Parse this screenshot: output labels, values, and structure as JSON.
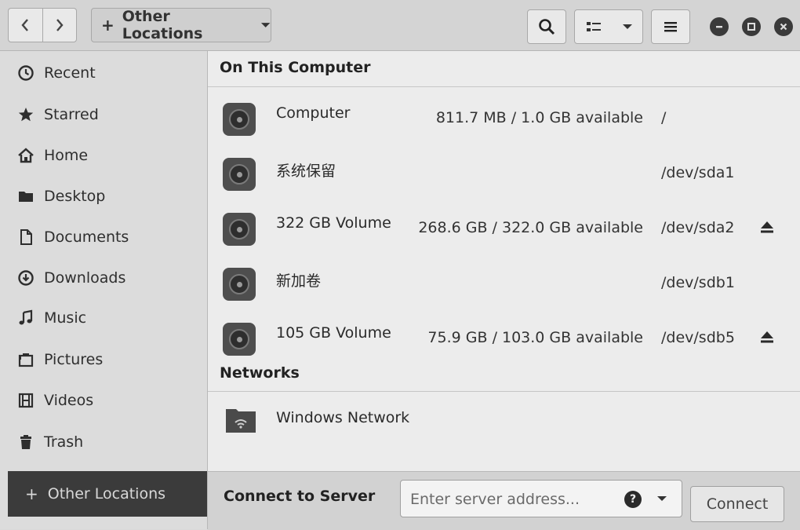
{
  "headerbar": {
    "path_label": "Other Locations",
    "icons": [
      "back-icon",
      "forward-icon",
      "search-icon",
      "list-view-icon",
      "menu-icon",
      "minimize-icon",
      "maximize-icon",
      "close-icon"
    ]
  },
  "sidebar": {
    "items": [
      {
        "label": "Recent",
        "icon": "clock-icon"
      },
      {
        "label": "Starred",
        "icon": "star-icon"
      },
      {
        "label": "Home",
        "icon": "home-icon"
      },
      {
        "label": "Desktop",
        "icon": "folder-icon"
      },
      {
        "label": "Documents",
        "icon": "document-icon"
      },
      {
        "label": "Downloads",
        "icon": "download-icon"
      },
      {
        "label": "Music",
        "icon": "music-icon"
      },
      {
        "label": "Pictures",
        "icon": "picture-icon"
      },
      {
        "label": "Videos",
        "icon": "film-icon"
      },
      {
        "label": "Trash",
        "icon": "trash-icon"
      }
    ],
    "other_locations": "Other Locations"
  },
  "main": {
    "on_this_computer": "On This Computer",
    "volumes": [
      {
        "name": "Computer",
        "available": "811.7 MB / 1.0 GB available",
        "device": "/",
        "ejectable": false
      },
      {
        "name": "系统保留",
        "available": "",
        "device": "/dev/sda1",
        "ejectable": false
      },
      {
        "name": "322 GB Volume",
        "available": "268.6 GB / 322.0 GB available",
        "device": "/dev/sda2",
        "ejectable": true
      },
      {
        "name": "新加卷",
        "available": "",
        "device": "/dev/sdb1",
        "ejectable": false
      },
      {
        "name": "105 GB Volume",
        "available": "75.9 GB / 103.0 GB available",
        "device": "/dev/sdb5",
        "ejectable": true
      }
    ],
    "networks": "Networks",
    "network_items": [
      {
        "name": "Windows Network",
        "icon": "network-folder-icon"
      }
    ]
  },
  "connect": {
    "label": "Connect to Server",
    "placeholder": "Enter server address...",
    "button": "Connect"
  },
  "colors": {
    "sidebar_selected_bg": "#3b3b3b",
    "window_bg": "#e4e4e4"
  }
}
